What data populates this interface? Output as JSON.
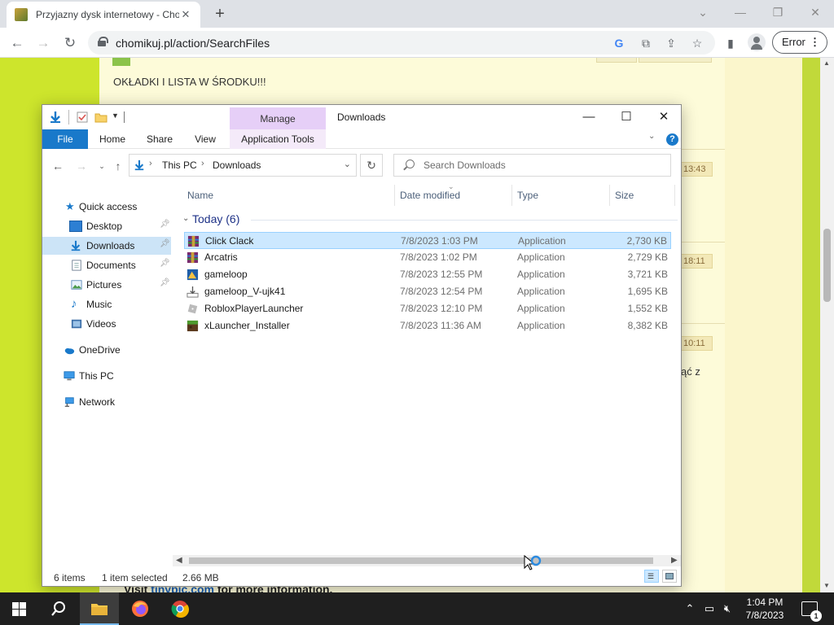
{
  "browser": {
    "tab_title": "Przyjazny dysk internetowy - Chomikuj.pl",
    "url": "chomikuj.pl/action/SearchFiles",
    "error_label": "Error"
  },
  "webpage": {
    "heading": "OKŁADKI I LISTA W ŚRODKU!!!",
    "times": [
      "13:43",
      "18:11",
      "10:11"
    ],
    "side_text": "ąć z",
    "bottom_prefix": "Visit",
    "bottom_link": "tinypic.com",
    "bottom_suffix": "for more information."
  },
  "explorer": {
    "title": "Downloads",
    "manage_tab": "Manage",
    "ribbon_tabs": [
      "File",
      "Home",
      "Share",
      "View",
      "Application Tools"
    ],
    "breadcrumb": [
      "This PC",
      "Downloads"
    ],
    "search_placeholder": "Search Downloads",
    "nav": {
      "quick_access": "Quick access",
      "items": [
        "Desktop",
        "Downloads",
        "Documents",
        "Pictures",
        "Music",
        "Videos"
      ],
      "onedrive": "OneDrive",
      "this_pc": "This PC",
      "network": "Network"
    },
    "columns": [
      "Name",
      "Date modified",
      "Type",
      "Size"
    ],
    "group_title": "Today (6)",
    "files": [
      {
        "name": "Click Clack",
        "date": "7/8/2023 1:03 PM",
        "type": "Application",
        "size": "2,730 KB"
      },
      {
        "name": "Arcatris",
        "date": "7/8/2023 1:02 PM",
        "type": "Application",
        "size": "2,729 KB"
      },
      {
        "name": "gameloop",
        "date": "7/8/2023 12:55 PM",
        "type": "Application",
        "size": "3,721 KB"
      },
      {
        "name": "gameloop_V-ujk41",
        "date": "7/8/2023 12:54 PM",
        "type": "Application",
        "size": "1,695 KB"
      },
      {
        "name": "RobloxPlayerLauncher",
        "date": "7/8/2023 12:10 PM",
        "type": "Application",
        "size": "1,552 KB"
      },
      {
        "name": "xLauncher_Installer",
        "date": "7/8/2023 11:36 AM",
        "type": "Application",
        "size": "8,382 KB"
      }
    ],
    "status": {
      "item_count": "6 items",
      "selected": "1 item selected",
      "selected_size": "2.66 MB"
    }
  },
  "taskbar": {
    "time": "1:04 PM",
    "date": "7/8/2023",
    "notification_count": "1"
  },
  "colors": {
    "accent": "#1979ca",
    "selection": "#cce8ff",
    "page_green": "#cde52c"
  }
}
